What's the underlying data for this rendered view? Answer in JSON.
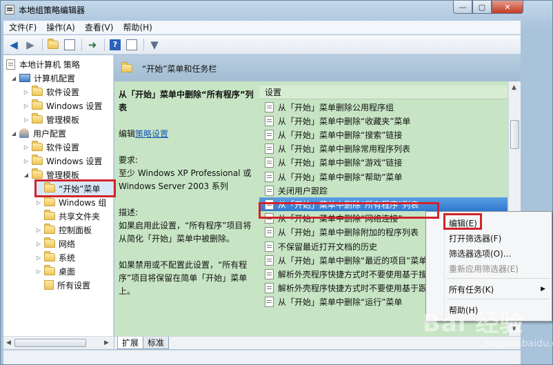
{
  "window": {
    "title": "本地组策略编辑器",
    "controls": {
      "minimize": "—",
      "maximize": "▢",
      "close": "✕"
    }
  },
  "menubar": {
    "items": [
      "文件(F)",
      "操作(A)",
      "查看(V)",
      "帮助(H)"
    ]
  },
  "toolbar": {
    "icons": [
      "back-arrow-icon",
      "forward-arrow-icon",
      "up-folder-icon",
      "show-hide-tree-icon",
      "export-list-icon",
      "help-icon",
      "properties-icon",
      "filter-icon"
    ]
  },
  "tree": {
    "items": [
      {
        "label": "本地计算机 策略",
        "icon": "policy-icon",
        "expanded": "open"
      },
      {
        "label": "计算机配置",
        "icon": "computer-icon",
        "expanded": "open"
      },
      {
        "label": "软件设置",
        "icon": "folder-icon",
        "expanded": "closed"
      },
      {
        "label": "Windows 设置",
        "icon": "folder-icon",
        "expanded": "closed"
      },
      {
        "label": "管理模板",
        "icon": "folder-icon",
        "expanded": "closed"
      },
      {
        "label": "用户配置",
        "icon": "user-icon",
        "expanded": "open"
      },
      {
        "label": "软件设置",
        "icon": "folder-icon",
        "expanded": "closed"
      },
      {
        "label": "Windows 设置",
        "icon": "folder-icon",
        "expanded": "closed"
      },
      {
        "label": "管理模板",
        "icon": "folder-icon",
        "expanded": "open"
      },
      {
        "label": "“开始”菜单",
        "icon": "folder-icon",
        "expanded": "none",
        "selected": true
      },
      {
        "label": "Windows 组",
        "icon": "folder-icon",
        "expanded": "closed"
      },
      {
        "label": "共享文件夹",
        "icon": "folder-icon",
        "expanded": "none"
      },
      {
        "label": "控制面板",
        "icon": "folder-icon",
        "expanded": "closed"
      },
      {
        "label": "网络",
        "icon": "folder-icon",
        "expanded": "closed"
      },
      {
        "label": "系统",
        "icon": "folder-icon",
        "expanded": "closed"
      },
      {
        "label": "桌面",
        "icon": "folder-icon",
        "expanded": "closed"
      },
      {
        "label": "所有设置",
        "icon": "all-settings-icon",
        "expanded": "none"
      }
    ]
  },
  "content": {
    "header": "“开始”菜单和任务栏",
    "description": {
      "title": "从「开始」菜单中删除“所有程序”列表",
      "edit_prefix": "编辑",
      "edit_link": "策略设置",
      "req_label": "要求:",
      "req_text": "至少 Windows XP Professional 或 Windows Server 2003 系列",
      "desc_label": "描述:",
      "desc_text1": "如果启用此设置，“所有程序”项目将从简化「开始」菜单中被删除。",
      "desc_text2": "如果禁用或不配置此设置，“所有程序”项目将保留在简单「开始」菜单上。"
    },
    "list_header": "设置",
    "settings": [
      "从「开始」菜单删除公用程序组",
      "从「开始」菜单中删除“收藏夹”菜单",
      "从「开始」菜单中删除“搜索”链接",
      "从「开始」菜单中删除常用程序列表",
      "从「开始」菜单中删除“游戏”链接",
      "从「开始」菜单中删除“帮助”菜单",
      "关闭用户跟踪",
      "从「开始」菜单中删除“所有程序”列表",
      "从「开始」菜单中删除“网络连接”",
      "从「开始」菜单中删除附加的程序列表",
      "不保留最近打开文档的历史",
      "从「开始」菜单中删除“最近的项目”菜单",
      "解析外壳程序快捷方式时不要使用基于搜",
      "解析外壳程序快捷方式时不要使用基于跟",
      "从「开始」菜单中删除“运行”菜单"
    ],
    "selected_index": 7
  },
  "tabs": [
    "扩展",
    "标准"
  ],
  "context_menu": {
    "items": [
      {
        "label": "编辑(E)",
        "disabled": false
      },
      {
        "label": "打开筛选器(F)",
        "disabled": false
      },
      {
        "label": "筛选器选项(O)...",
        "disabled": false
      },
      {
        "label": "重新应用筛选器(E)",
        "disabled": true
      },
      {
        "label": "所有任务(K)",
        "disabled": false,
        "submenu": true
      },
      {
        "label": "帮助(H)",
        "disabled": false
      }
    ]
  },
  "watermark": {
    "main": "Bai 经验",
    "sub": "jingyan.baidu.com"
  },
  "colors": {
    "highlight": "#2f78cf",
    "annotation_red": "#d1232a",
    "content_bg": "#c7e5c4"
  }
}
